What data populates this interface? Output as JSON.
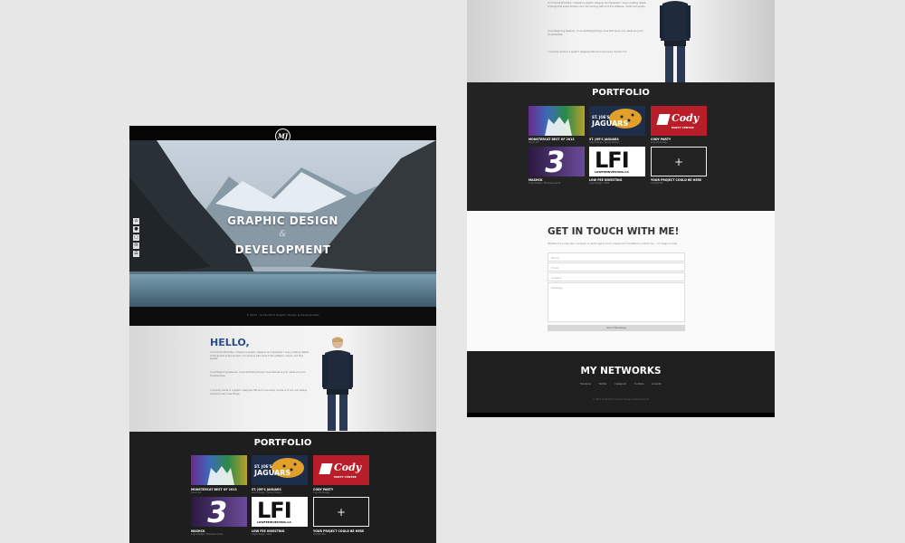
{
  "left_mockup": {
    "logo_text": "MJ",
    "hero": {
      "title_line1": "GRAPHIC DESIGN",
      "ampersand": "&",
      "title_line2": "DEVELOPMENT"
    },
    "side_nav_icons": [
      "home-icon",
      "user-icon",
      "portfolio-icon",
      "contact-icon",
      "network-icon"
    ],
    "footer_text": "© 2013 · La Montfort Graphic Design & Development",
    "hello": {
      "title": "HELLO,",
      "paragraphs": [
        "I'm Dominik McCarthy, a freelance graphic designer and developer. I enjoy creating details of things that evoke emotion. I'm working with loads of the software, clients, and their people.",
        "I love Beginning Sessions, I love identifying things I love that serve your needs and your fundamentals.",
        "I currently reside in a graphic designers flat and I love every minute of it and I am always looking to learn new things."
      ]
    },
    "portfolio": {
      "title": "PORTFOLIO",
      "items": [
        {
          "label": "MONSTERCAT BEST OF 2013",
          "sub": "Cover Art"
        },
        {
          "label": "ST. JOE'S JAGUARS",
          "sub": "Logo Design / Jersey Design"
        },
        {
          "label": "CODY PARTY",
          "sub": "Logo Re-Design"
        },
        {
          "label": "MASHCK",
          "sub": "Logo Design / Business Cards"
        },
        {
          "label": "LOW FEE INVESTING",
          "sub": "Logo Design / Web"
        },
        {
          "label": "YOUR PROJECT COULD BE HERE",
          "sub": "Contact Me"
        }
      ],
      "tile_texts": {
        "jaguars_line1": "ST. JOE'S",
        "jaguars_line2": "JAGUARS",
        "cody": "Cody",
        "cody_sub": "PARTY CENTRE",
        "mashck": "3",
        "lfi": "LFI",
        "lfi_sub": "LOWFEEINVESTING.CA",
        "plus": "+"
      }
    }
  },
  "right_mockup": {
    "hello_paragraphs": [
      "I'm Dominik McCarthy, a freelance graphic designer and developer. I enjoy creating details of things that evoke emotion and I am working with all of the software, clients and people.",
      "I love Beginning Sessions, I love identifying things I love that serve your needs and your fundamentals.",
      "I currently reside in a graphic designers flat and I love every minute of it."
    ],
    "portfolio_title": "PORTFOLIO",
    "contact": {
      "title": "GET IN TOUCH WITH ME!",
      "paragraph": "Whether it's a new idea, a project, or just to get in touch, please don't hesitate to contact me — I'm happy to help.",
      "name_placeholder": "Name",
      "email_placeholder": "Email",
      "subject_placeholder": "Subject",
      "message_placeholder": "Message",
      "send_label": "Send Message"
    },
    "networks": {
      "title": "MY NETWORKS",
      "links": [
        "Facebook",
        "Twitter",
        "Instagram",
        "YouTube",
        "LinkedIn"
      ],
      "footer_text": "© 2013 La Montfort Graphic Design & Development"
    }
  },
  "colors": {
    "background": "#e7e7e7",
    "hello_accent": "#2a4d88",
    "dark": "#1e1e1e"
  }
}
